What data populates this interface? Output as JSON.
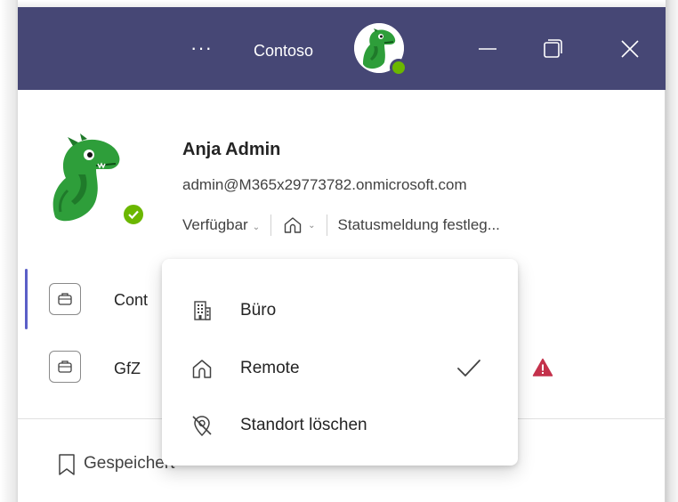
{
  "titlebar": {
    "more_label": "···",
    "org_name": "Contoso",
    "colors": {
      "background": "#464775",
      "presence_available": "#6bb700"
    },
    "controls": {
      "minimize": "minimize-icon",
      "restore": "restore-icon",
      "close": "close-icon"
    }
  },
  "profile": {
    "name": "Anja Admin",
    "email": "admin@M365x29773782.onmicrosoft.com",
    "presence_label": "Verfügbar",
    "location_icon": "home-icon",
    "status_message_label": "Statusmeldung festleg..."
  },
  "accounts": [
    {
      "label": "Cont",
      "icon": "briefcase-icon",
      "active": true
    },
    {
      "label": "GfZ",
      "icon": "briefcase-icon",
      "active": false,
      "warning": true
    }
  ],
  "saved_label": "Gespeichert",
  "location_menu": {
    "items": [
      {
        "label": "Büro",
        "icon": "building-icon",
        "selected": false
      },
      {
        "label": "Remote",
        "icon": "home-icon",
        "selected": true
      },
      {
        "label": "Standort löschen",
        "icon": "location-off-icon",
        "selected": false
      }
    ]
  },
  "colors": {
    "accent": "#5b5fc7",
    "warning": "#c4314b"
  }
}
